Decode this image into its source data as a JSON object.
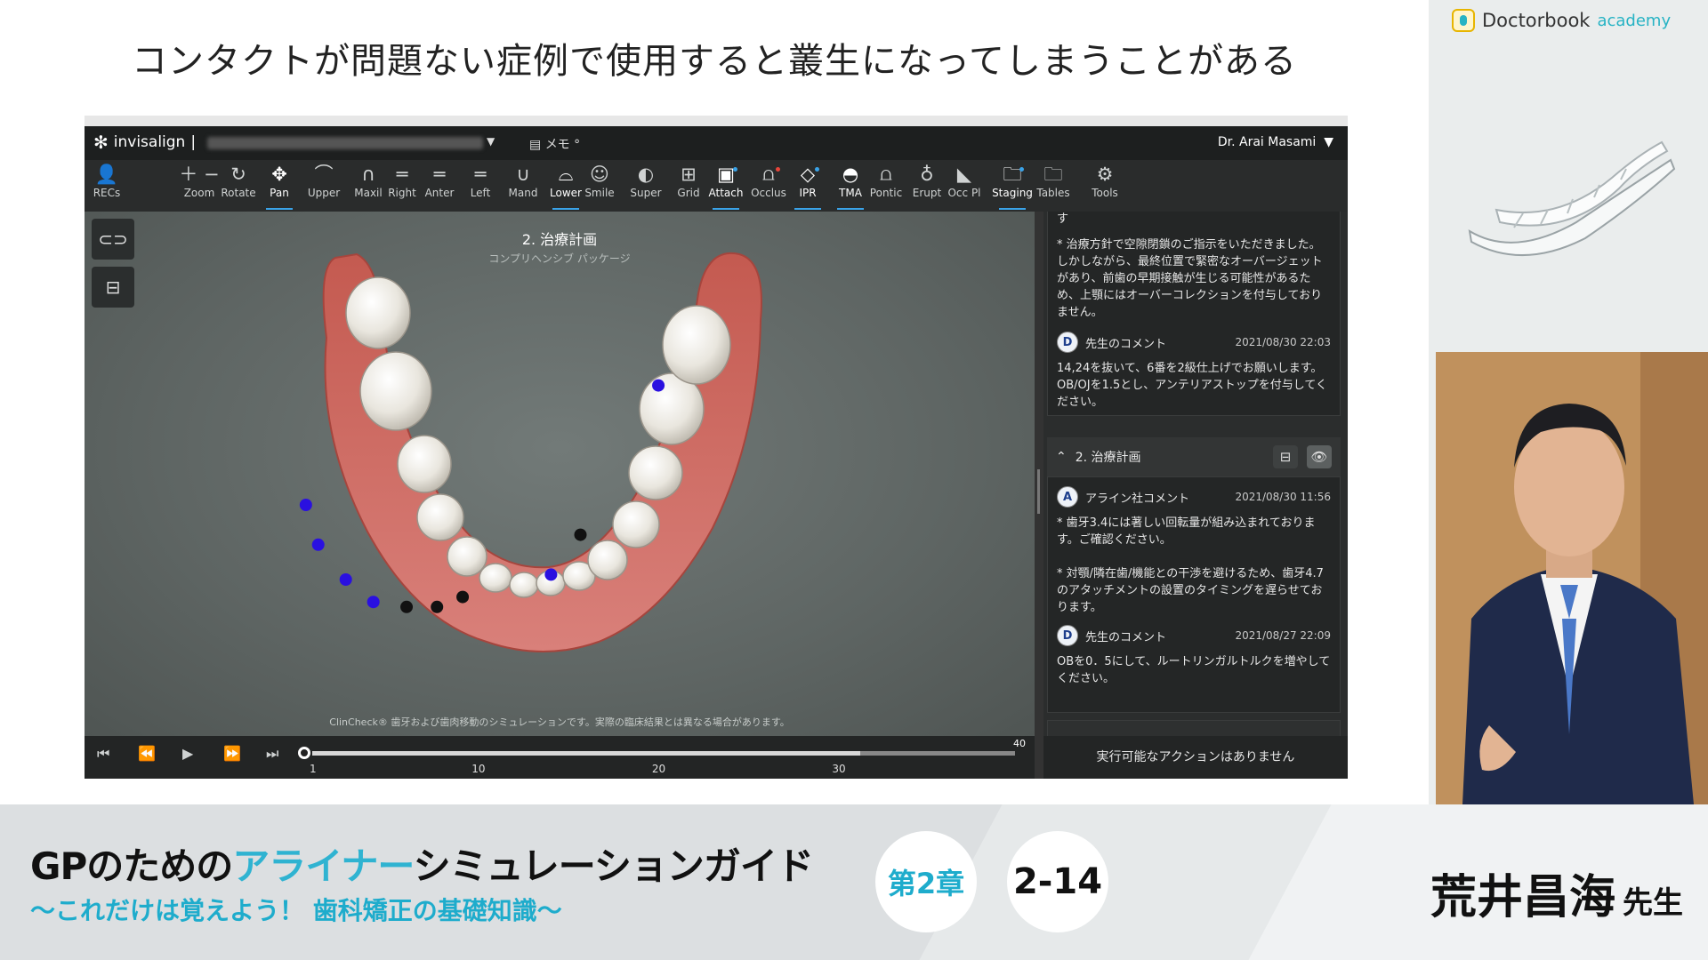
{
  "slide": {
    "headline": "コンタクトが問題ない症例で使用すると叢生になってしまうことがある"
  },
  "app": {
    "name": "invisalign",
    "memo_label": "メモ",
    "doctor": "Dr. Arai Masami",
    "toolbar": [
      {
        "id": "recs",
        "label": "RECs",
        "icon": "👤"
      },
      {
        "id": "zoom",
        "label": "Zoom",
        "icon": "＋ −"
      },
      {
        "id": "rotate",
        "label": "Rotate",
        "icon": "↻"
      },
      {
        "id": "pan",
        "label": "Pan",
        "icon": "✥",
        "active": true
      },
      {
        "id": "upper",
        "label": "Upper",
        "icon": "⌒"
      },
      {
        "id": "maxil",
        "label": "Maxil",
        "icon": "∩"
      },
      {
        "id": "right",
        "label": "Right",
        "icon": "═"
      },
      {
        "id": "anter",
        "label": "Anter",
        "icon": "═"
      },
      {
        "id": "left",
        "label": "Left",
        "icon": "═"
      },
      {
        "id": "mand",
        "label": "Mand",
        "icon": "∪"
      },
      {
        "id": "lower",
        "label": "Lower",
        "icon": "⌓",
        "active": true
      },
      {
        "id": "smile",
        "label": "Smile",
        "icon": "☺"
      },
      {
        "id": "super",
        "label": "Super",
        "icon": "◐"
      },
      {
        "id": "grid",
        "label": "Grid",
        "icon": "⊞"
      },
      {
        "id": "attach",
        "label": "Attach",
        "icon": "▣",
        "active": true,
        "dot": "blue"
      },
      {
        "id": "occlus",
        "label": "Occlus",
        "icon": "⩍",
        "dot": "red"
      },
      {
        "id": "ipr",
        "label": "IPR",
        "icon": "◇",
        "active": true,
        "dot": "blue"
      },
      {
        "id": "tma",
        "label": "TMA",
        "icon": "◓",
        "active": true
      },
      {
        "id": "pontic",
        "label": "Pontic",
        "icon": "⩍"
      },
      {
        "id": "erupt",
        "label": "Erupt",
        "icon": "♁"
      },
      {
        "id": "occpl",
        "label": "Occ Pl",
        "icon": "◣"
      },
      {
        "id": "staging",
        "label": "Staging",
        "icon": "🗀",
        "active": true,
        "dot": "blue"
      },
      {
        "id": "tables",
        "label": "Tables",
        "icon": "🗀"
      },
      {
        "id": "tools",
        "label": "Tools",
        "icon": "⚙"
      }
    ],
    "viewport": {
      "title": "2. 治療計画",
      "subtitle": "コンプリヘンシブ パッケージ",
      "disclaimer": "ClinCheck® 歯牙および歯肉移動のシミュレーションです。実際の臨床結果とは異なる場合があります。"
    },
    "timeline": {
      "ticks": [
        "1",
        "10",
        "20",
        "30"
      ],
      "max_label": "40",
      "current_stage": 1,
      "max_stage": 40,
      "progress": 0.78
    },
    "panel": {
      "partial_top": "す",
      "note1": "* 治療方針で空隙閉鎖のご指示をいただきました。しかしながら、最終位置で緊密なオーバージェットがあり、前歯の早期接触が生じる可能性があるため、上顎にはオーバーコレクションを付与しておりません。",
      "c1_avatar": "D",
      "c1_author": "先生のコメント",
      "c1_date": "2021/08/30 22:03",
      "c1_text": "14,24を抜いて、6番を2級仕上げでお願いします。OB/OJを1.5とし、アンテリアストップを付与してください。",
      "section_title": "2. 治療計画",
      "c2_avatar": "A",
      "c2_author": "アライン社コメント",
      "c2_date": "2021/08/30 11:56",
      "c2_text1": "* 歯牙3.4には著しい回転量が組み込まれております。ご確認ください。",
      "c2_text2": "* 対顎/隣在歯/機能との干渉を避けるため、歯牙4.7のアタッチメントの設置のタイミングを遅らせております。",
      "c3_avatar": "D",
      "c3_author": "先生のコメント",
      "c3_date": "2021/08/27 22:09",
      "c3_text": "OBを0．5にして、ルートリンガルトルクを増やしてください。",
      "footer": "実行可能なアクションはありません"
    }
  },
  "brand": {
    "name": "Doctorbook",
    "suffix": "academy"
  },
  "lower_third": {
    "title_pre": "GPのための",
    "title_hl": "アライナー",
    "title_post": "シミュレーションガイド",
    "subtitle": "〜これだけは覚えよう！ 歯科矯正の基礎知識〜",
    "chapter": "第2章",
    "number": "2-14",
    "presenter_name": "荒井昌海",
    "presenter_suffix": "先生"
  },
  "colors": {
    "accent": "#2fb3d1",
    "attachment_marker": "#2a10e0",
    "ipr_marker": "#111111",
    "gum": "#c9645a"
  },
  "markers": {
    "attachments": [
      [
        0.604,
        0.31
      ],
      [
        0.233,
        0.55
      ],
      [
        0.246,
        0.63
      ],
      [
        0.275,
        0.7
      ],
      [
        0.304,
        0.745
      ],
      [
        0.491,
        0.69
      ]
    ],
    "ipr": [
      [
        0.522,
        0.61
      ],
      [
        0.339,
        0.755
      ],
      [
        0.371,
        0.755
      ],
      [
        0.398,
        0.735
      ]
    ]
  }
}
